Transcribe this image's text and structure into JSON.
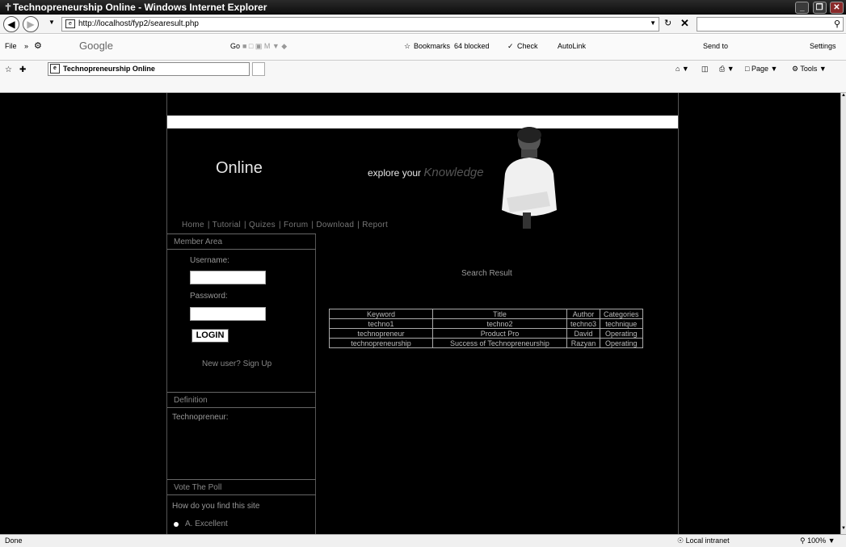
{
  "window": {
    "title": "Technopreneurship Online - Windows Internet Explorer",
    "minimize_icon": "minimize-icon",
    "maximize_icon": "restore-icon",
    "close_icon": "close-icon"
  },
  "address_bar": {
    "url": "http://localhost/fyp2/searesult.php"
  },
  "toolbar": {
    "file_menu": "File",
    "google_label": "Google",
    "go_label": "Go",
    "bookmarks": "Bookmarks",
    "blocked": "64 blocked",
    "check": "Check",
    "autolink": "AutoLink",
    "send_to": "Send to",
    "settings": "Settings"
  },
  "tabs": {
    "active_tab": "Technopreneurship Online",
    "page_menu": "Page",
    "tools_menu": "Tools"
  },
  "site": {
    "logo": "Online",
    "slogan_prefix": "explore your",
    "slogan_emphasis": "Knowledge",
    "nav": [
      "Home",
      "Tutorial",
      "Quizes",
      "Forum",
      "Download",
      "Report"
    ]
  },
  "sidebar": {
    "member_area": "Member Area",
    "username_label": "Username:",
    "password_label": "Password:",
    "login_button": "LOGIN",
    "signup": "New user? Sign Up",
    "definition_header": "Definition",
    "definition_term": "Technopreneur:",
    "poll_header": "Vote The Poll",
    "poll_question": "How do you find this site",
    "poll_option_a": "A. Excellent"
  },
  "search": {
    "title": "Search Result",
    "columns": [
      "Keyword",
      "Title",
      "Author",
      "Categories"
    ],
    "rows": [
      [
        "techno1",
        "techno2",
        "techno3",
        "technique"
      ],
      [
        "technopreneur",
        "Product Pro",
        "David",
        "Operating"
      ],
      [
        "technopreneurship",
        "Success of Technopreneurship",
        "Razyan",
        "Operating"
      ]
    ]
  },
  "status": {
    "text": "Done",
    "zone": "Local intranet",
    "zoom": "100%"
  }
}
